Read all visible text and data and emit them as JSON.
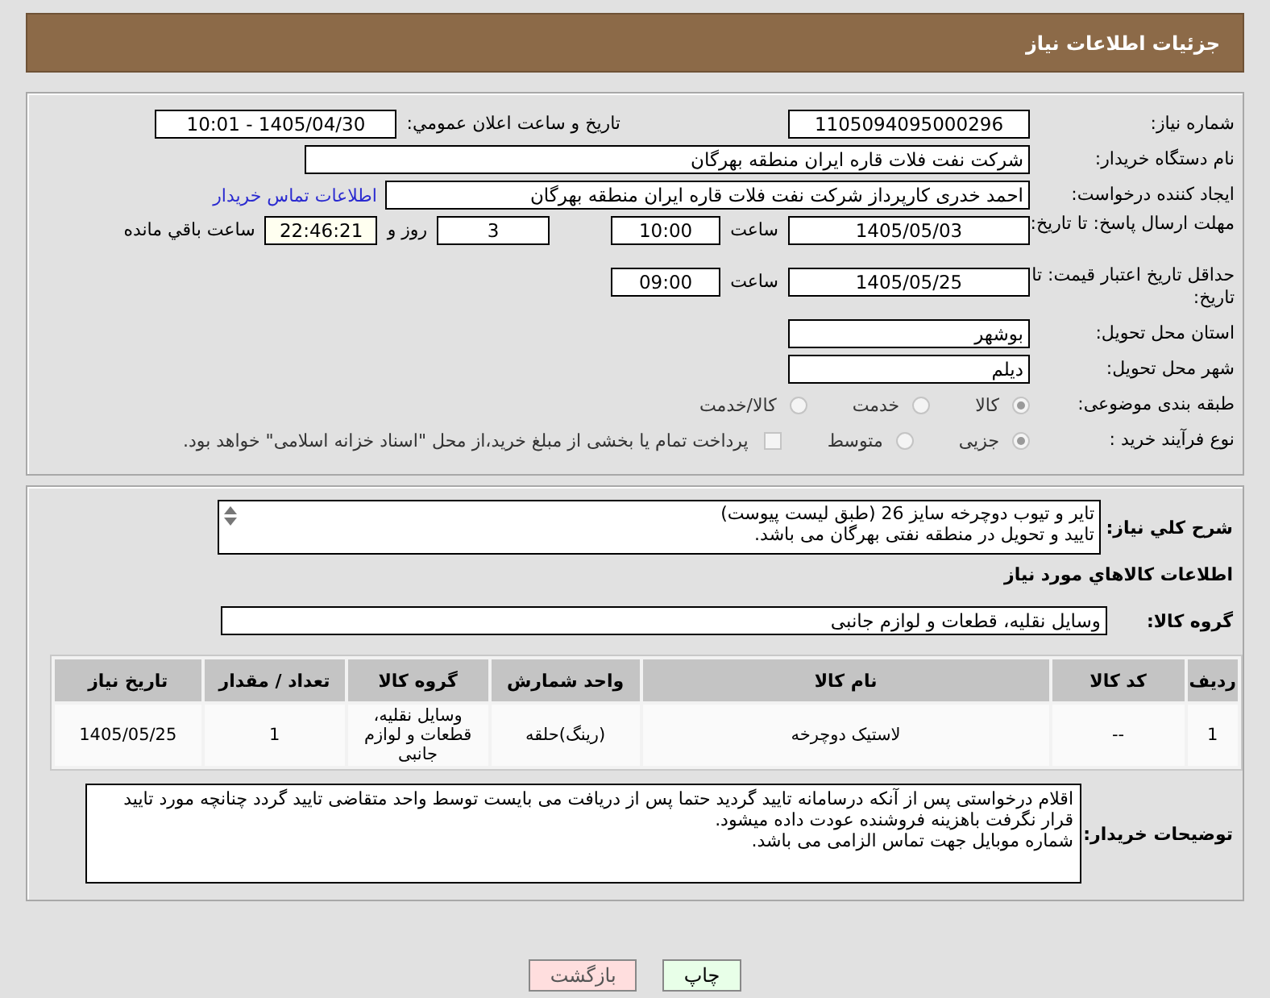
{
  "header": {
    "title": "جزئیات اطلاعات نیاز"
  },
  "general": {
    "need_number": {
      "label": "شماره نیاز:",
      "value": "1105094095000296"
    },
    "announce": {
      "label": "تاریخ و ساعت اعلان عمومي:",
      "value": "1405/04/30 - 10:01"
    },
    "buyer": {
      "label": "نام دستگاه خریدار:",
      "value": "شرکت نفت فلات قاره ایران منطقه بهرگان"
    },
    "requester": {
      "label": "ایجاد کننده درخواست:",
      "value": "احمد خدری کارپرداز شرکت نفت فلات قاره ایران منطقه بهرگان",
      "link": "اطلاعات تماس خریدار"
    },
    "deadline": {
      "label": "مهلت ارسال پاسخ: تا تاریخ:",
      "date": "1405/05/03",
      "time_label": "ساعت",
      "time": "10:00",
      "days": "3",
      "days_label": "روز و",
      "remaining": "22:46:21",
      "remaining_label": "ساعت باقي مانده"
    },
    "validity": {
      "label": "حداقل تاریخ اعتبار قیمت: تا تاریخ:",
      "date": "1405/05/25",
      "time_label": "ساعت",
      "time": "09:00"
    },
    "province": {
      "label": "استان محل تحویل:",
      "value": "بوشهر"
    },
    "city": {
      "label": "شهر محل تحویل:",
      "value": "دیلم"
    },
    "category": {
      "label": "طبقه بندی موضوعی:",
      "options": [
        {
          "label": "کالا",
          "selected": true
        },
        {
          "label": "خدمت",
          "selected": false
        },
        {
          "label": "کالا/خدمت",
          "selected": false
        }
      ]
    },
    "process": {
      "label": "نوع فرآیند خرید :",
      "options": [
        {
          "label": "جزیی",
          "selected": true
        },
        {
          "label": "متوسط",
          "selected": false
        }
      ],
      "payment": {
        "checked": false,
        "text": "پرداخت تمام یا بخشی از مبلغ خرید،از محل \"اسناد خزانه اسلامی\" خواهد بود."
      }
    }
  },
  "details": {
    "description": {
      "label": "شرح کلي نیاز:",
      "value": "تایر و تیوب دوچرخه سایز 26 (طبق لیست پیوست)\nتایید و تحویل در منطقه نفتی بهرگان می باشد."
    },
    "goods_heading": "اطلاعات کالاهاي مورد نیاز",
    "group": {
      "label": "گروه کالا:",
      "value": "وسایل نقلیه، قطعات و لوازم جانبی"
    },
    "table": {
      "columns": [
        "ردیف",
        "کد کالا",
        "نام کالا",
        "واحد شمارش",
        "گروه کالا",
        "تعداد / مقدار",
        "تاریخ نیاز"
      ],
      "rows": [
        [
          "1",
          "--",
          "لاستیک دوچرخه",
          "(رینگ)حلقه",
          "وسایل نقلیه، قطعات و لوازم جانبی",
          "1",
          "1405/05/25"
        ]
      ]
    },
    "notes": {
      "label": "توضیحات خریدار:",
      "value": "اقلام درخواستی پس از آنکه درسامانه تایید گردید حتما پس از دریافت می بایست توسط واحد متقاضی تایید گردد چنانچه مورد تایید قرار نگرفت باهزینه فروشنده عودت داده میشود.\nشماره موبایل جهت تماس الزامی می باشد."
    }
  },
  "buttons": [
    {
      "label": "چاپ",
      "kind": "print"
    },
    {
      "label": "بازگشت",
      "kind": "back"
    }
  ]
}
